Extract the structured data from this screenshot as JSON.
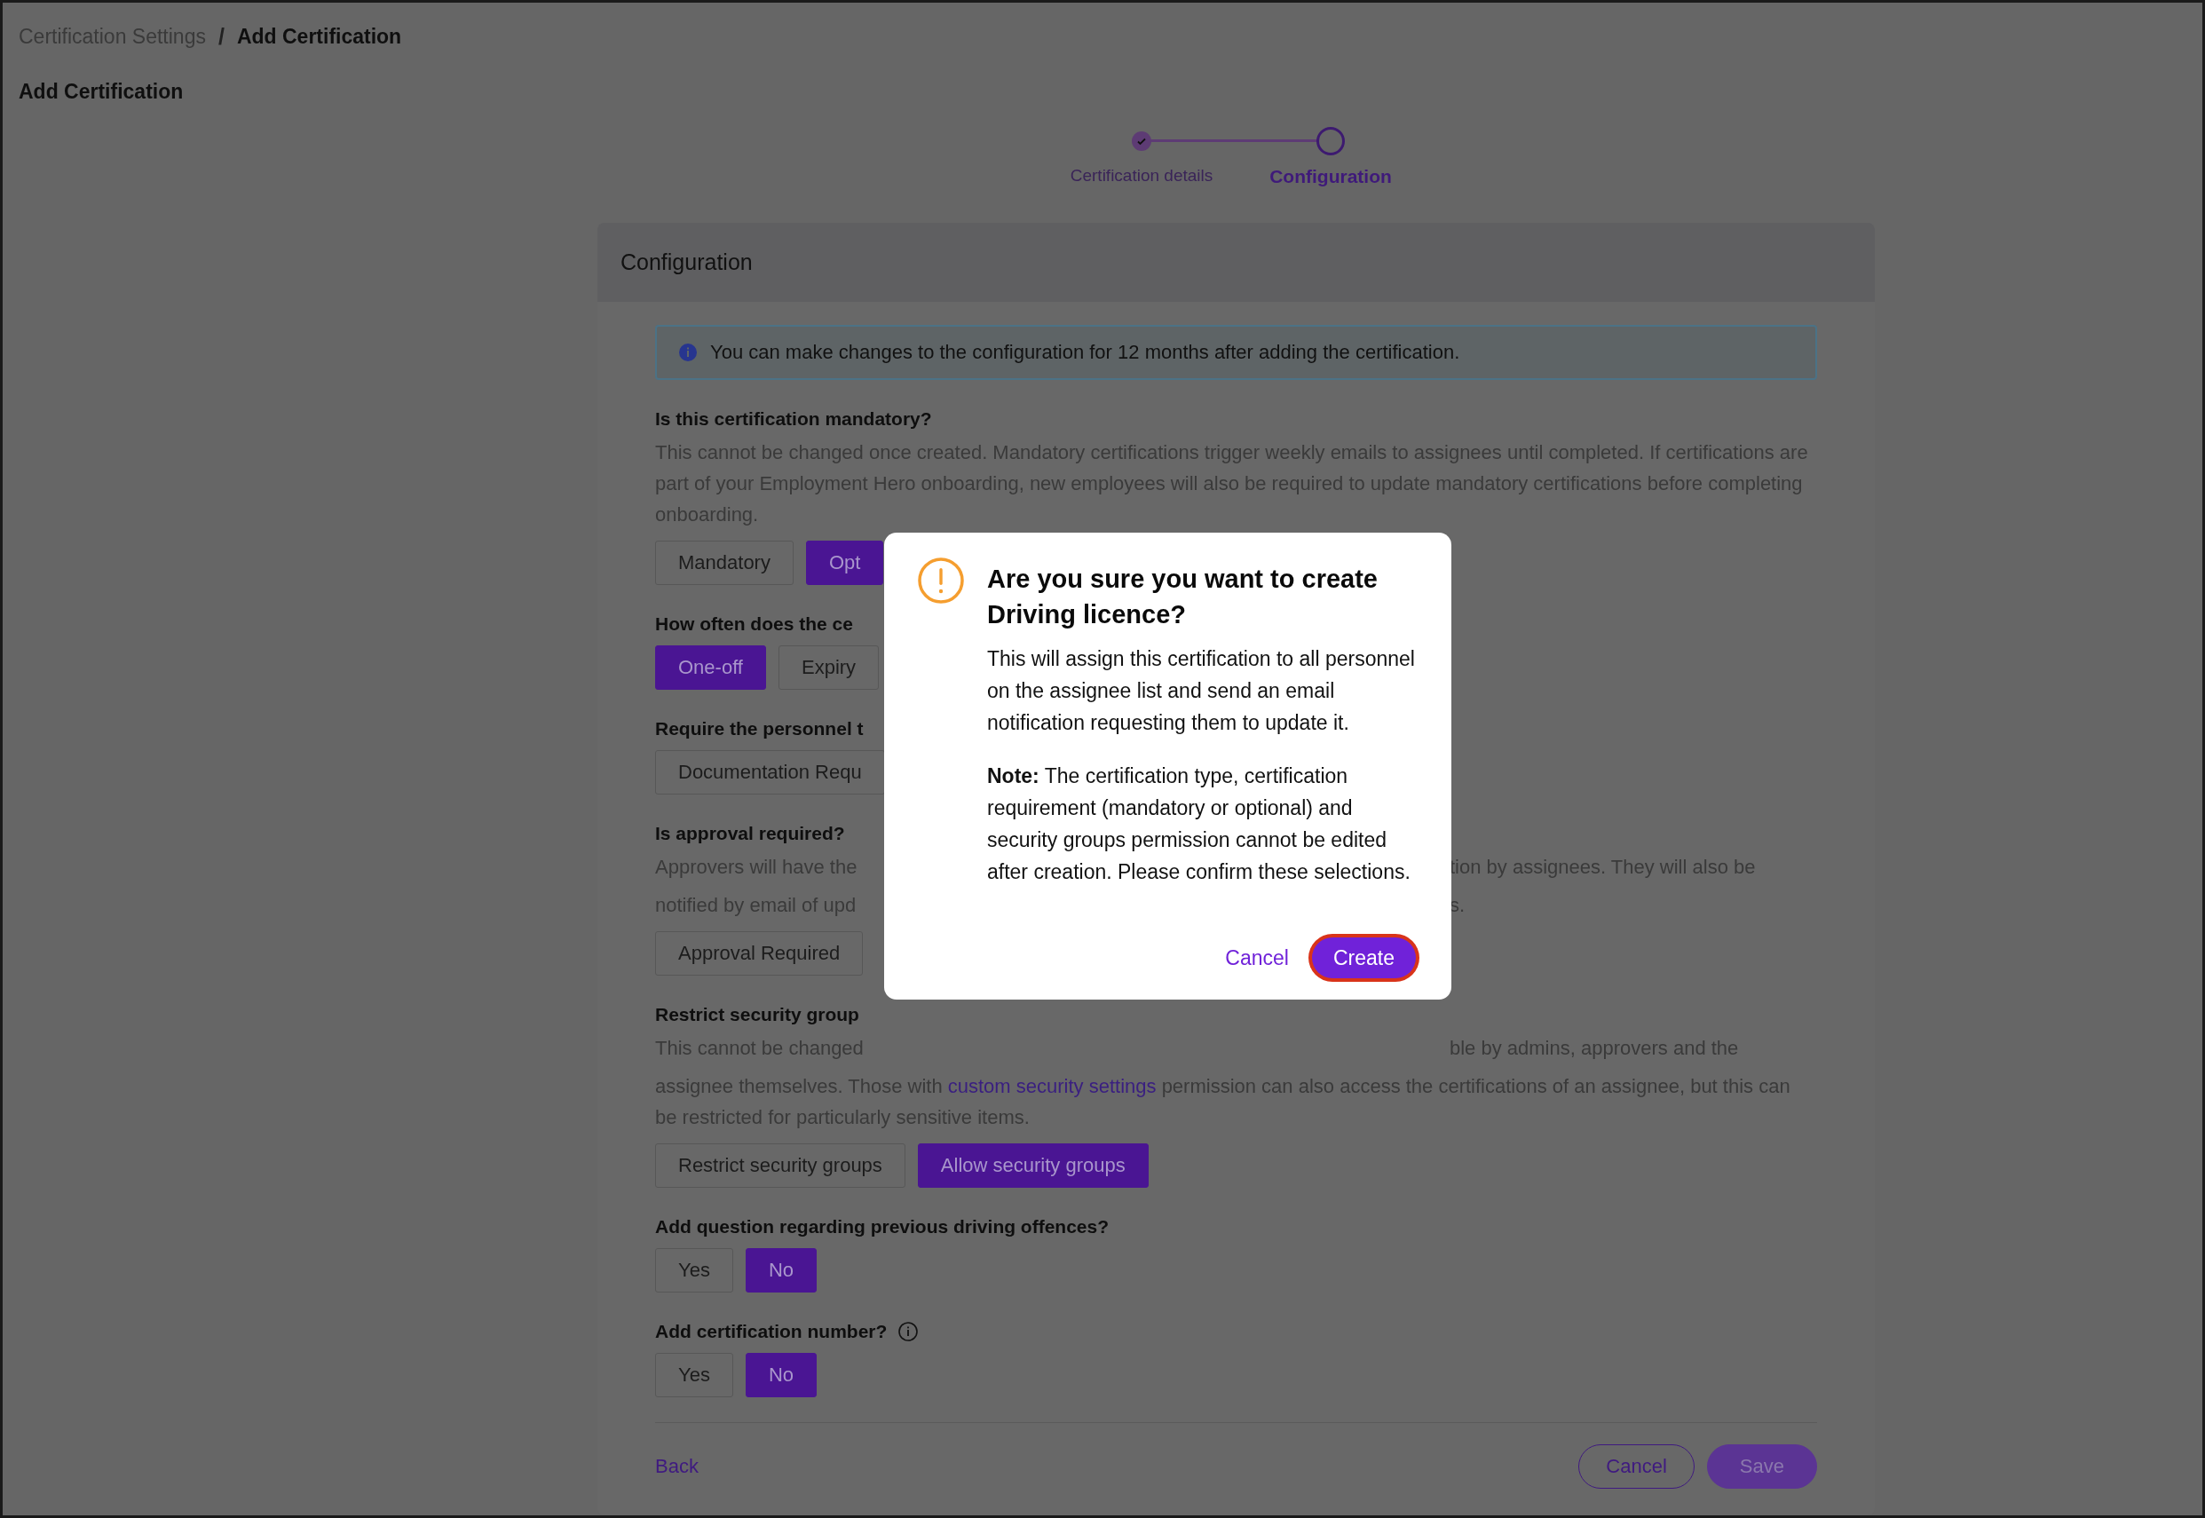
{
  "breadcrumb": [
    {
      "label": "Certification Settings",
      "current": false
    },
    {
      "label": "Add Certification",
      "current": true
    }
  ],
  "separator": "/",
  "page_title": "Add Certification",
  "stepper": [
    {
      "label": "Certification details",
      "completed": true,
      "selected": false
    },
    {
      "label": "Configuration",
      "completed": false,
      "selected": true
    }
  ],
  "card": {
    "title": "Configuration",
    "info_banner": "You can make changes to the configuration for 12 months after adding the certification.",
    "questions": [
      {
        "title": "Is this certification mandatory?",
        "description": [
          {
            "segments": [
              {
                "kind": "text",
                "text": "This cannot be changed once created. Mandatory certifications trigger weekly emails to assignees until completed. If certifications are part of your Employment Hero onboarding, new employees will also be required to update mandatory certifications before completing onboarding."
              }
            ]
          }
        ],
        "options": [
          {
            "label": "Mandatory",
            "selected": false
          },
          {
            "label": "Opt",
            "selected": true
          }
        ]
      },
      {
        "title": "How often does the ce",
        "options": [
          {
            "label": "One-off",
            "selected": true
          },
          {
            "label": "Expiry",
            "selected": false
          }
        ]
      },
      {
        "title": "Require the personnel t",
        "options": [
          {
            "label": "Documentation Requ",
            "selected": false
          }
        ]
      },
      {
        "title": "Is approval required?",
        "description": [
          {
            "text": "Approvers will have the",
            "right": "tion by assignees. They will also be"
          },
          {
            "text": "notified by email of upd",
            "right": "s."
          }
        ],
        "options": [
          {
            "label": "Approval Required",
            "selected": false
          }
        ]
      },
      {
        "title": "Restrict security group",
        "description": [
          {
            "text": "This cannot be changed",
            "right": "ble by admins, approvers and the"
          },
          {
            "segments": [
              {
                "kind": "text",
                "text": "assignee themselves. Those with "
              },
              {
                "kind": "link",
                "text": "custom security settings"
              },
              {
                "kind": "text",
                "text": " permission can also access the certifications of an assignee, but this can be restricted for particularly sensitive items."
              }
            ]
          }
        ],
        "options": [
          {
            "label": "Restrict security groups",
            "selected": false
          },
          {
            "label": "Allow security groups",
            "selected": true
          }
        ]
      },
      {
        "title": "Add question regarding previous driving offences?",
        "options": [
          {
            "label": "Yes",
            "selected": false
          },
          {
            "label": "No",
            "selected": true
          }
        ]
      },
      {
        "title": "Add certification number?",
        "info_icon": true,
        "options": [
          {
            "label": "Yes",
            "selected": false
          },
          {
            "label": "No",
            "selected": true
          }
        ]
      }
    ],
    "footer": {
      "back": "Back",
      "buttons": [
        {
          "label": "Cancel",
          "kind": "outline"
        },
        {
          "label": "Save",
          "kind": "primary"
        }
      ]
    }
  },
  "dialog": {
    "title": "Are you sure you want to create Driving licence?",
    "paragraphs": [
      "This will assign this certification to all personnel on the assignee list and send an email notification requesting them to update it.",
      "**Note:** The certification type, certification requirement (mandatory or optional) and security groups permission cannot be edited after creation. Please confirm these selections."
    ],
    "buttons": [
      {
        "label": "Cancel",
        "kind": "link"
      },
      {
        "label": "Create",
        "kind": "primary",
        "focused": true
      }
    ]
  }
}
